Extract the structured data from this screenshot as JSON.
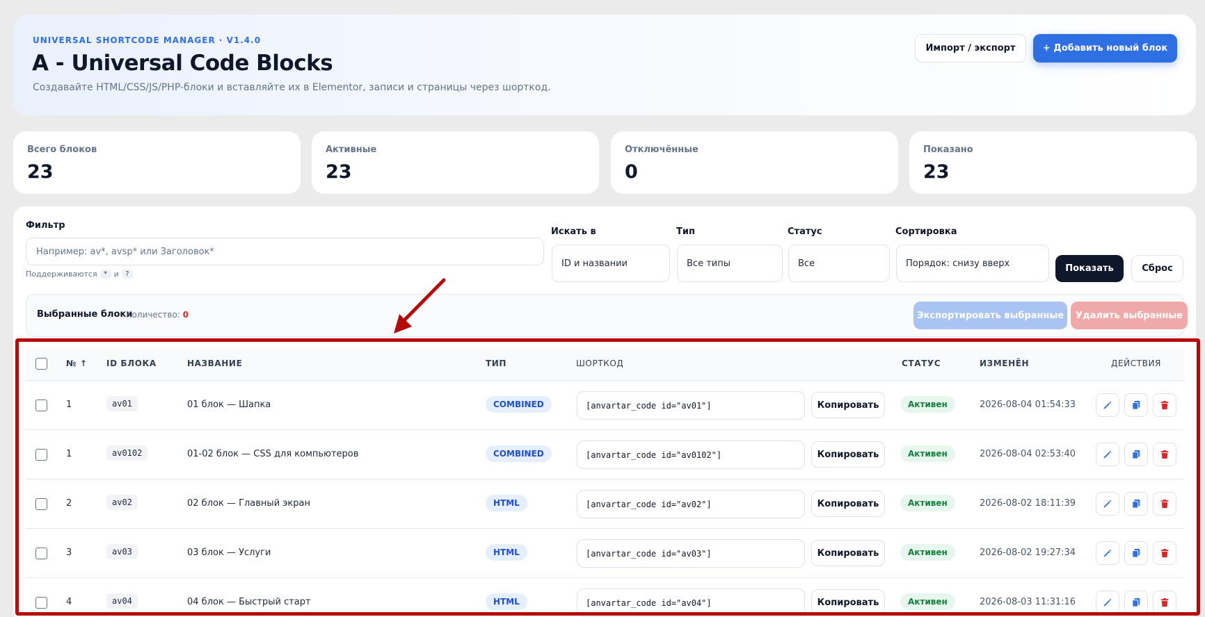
{
  "header": {
    "kicker": "UNIVERSAL SHORTCODE MANAGER · V1.4.0",
    "title": "A - Universal Code Blocks",
    "subtitle": "Создавайте HTML/CSS/JS/PHP-блоки и вставляйте их в Elementor, записи и страницы через шорткод.",
    "import_export_label": "Импорт / экспорт",
    "add_block_label": "+ Добавить новый блок"
  },
  "stats": [
    {
      "label": "Всего блоков",
      "value": "23"
    },
    {
      "label": "Активные",
      "value": "23"
    },
    {
      "label": "Отключённые",
      "value": "0"
    },
    {
      "label": "Показано",
      "value": "23"
    }
  ],
  "filter": {
    "label": "Фильтр",
    "placeholder": "Например: av*, avsp* или Заголовок*",
    "hint_prefix": "Поддерживаются",
    "hint_wildcard_1": "*",
    "hint_and": "и",
    "hint_wildcard_2": "?",
    "search_in_label": "Искать в",
    "search_in_value": "ID и названии",
    "type_label": "Тип",
    "type_value": "Все типы",
    "status_label": "Статус",
    "status_value": "Все",
    "sort_label": "Сортировка",
    "sort_value": "Порядок: снизу вверх",
    "show_label": "Показать",
    "reset_label": "Сброс"
  },
  "selection": {
    "title": "Выбранные блоки",
    "count_label": "Количество:",
    "count": "0",
    "export_label": "Экспортировать выбранные",
    "delete_label": "Удалить выбранные"
  },
  "table": {
    "columns": {
      "num": "№ ↑",
      "id": "ID БЛОКА",
      "name": "НАЗВАНИЕ",
      "type": "ТИП",
      "shortcode": "ШОРТКОД",
      "status": "СТАТУС",
      "modified": "ИЗМЕНЁН",
      "actions": "ДЕЙСТВИЯ"
    },
    "copy_label": "Копировать",
    "rows": [
      {
        "num": "1",
        "id": "av01",
        "name": "01 блок — Шапка",
        "type": "COMBINED",
        "shortcode": "[anvartar_code id=\"av01\"]",
        "status": "Активен",
        "modified": "2026-08-04 01:54:33"
      },
      {
        "num": "1",
        "id": "av0102",
        "name": "01-02 блок — CSS для компьютеров",
        "type": "COMBINED",
        "shortcode": "[anvartar_code id=\"av0102\"]",
        "status": "Активен",
        "modified": "2026-08-04 02:53:40"
      },
      {
        "num": "2",
        "id": "av02",
        "name": "02 блок — Главный экран",
        "type": "HTML",
        "shortcode": "[anvartar_code id=\"av02\"]",
        "status": "Активен",
        "modified": "2026-08-02 18:11:39"
      },
      {
        "num": "3",
        "id": "av03",
        "name": "03 блок — Услуги",
        "type": "HTML",
        "shortcode": "[anvartar_code id=\"av03\"]",
        "status": "Активен",
        "modified": "2026-08-02 19:27:34"
      },
      {
        "num": "4",
        "id": "av04",
        "name": "04 блок — Быстрый старт",
        "type": "HTML",
        "shortcode": "[anvartar_code id=\"av04\"]",
        "status": "Активен",
        "modified": "2026-08-03 11:31:16"
      }
    ]
  },
  "colors": {
    "accent": "#2f6fe4",
    "dark": "#0f172a",
    "danger": "#dc2626",
    "success": "#15803d",
    "annotation": "#b70b0b"
  }
}
